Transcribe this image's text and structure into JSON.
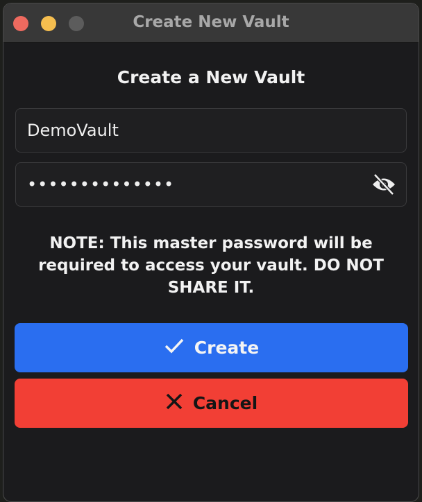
{
  "window": {
    "title": "Create New Vault"
  },
  "dialog": {
    "heading": "Create a New Vault",
    "vault_name": {
      "value": "DemoVault"
    },
    "password": {
      "value": "••••••••••••••",
      "toggle_icon": "eye-slash-icon"
    },
    "note": "NOTE: This master password will be required to access your vault. DO NOT SHARE IT.",
    "create_label": "Create",
    "cancel_label": "Cancel"
  },
  "colors": {
    "create": "#2a6ef0",
    "cancel": "#f23f35"
  }
}
